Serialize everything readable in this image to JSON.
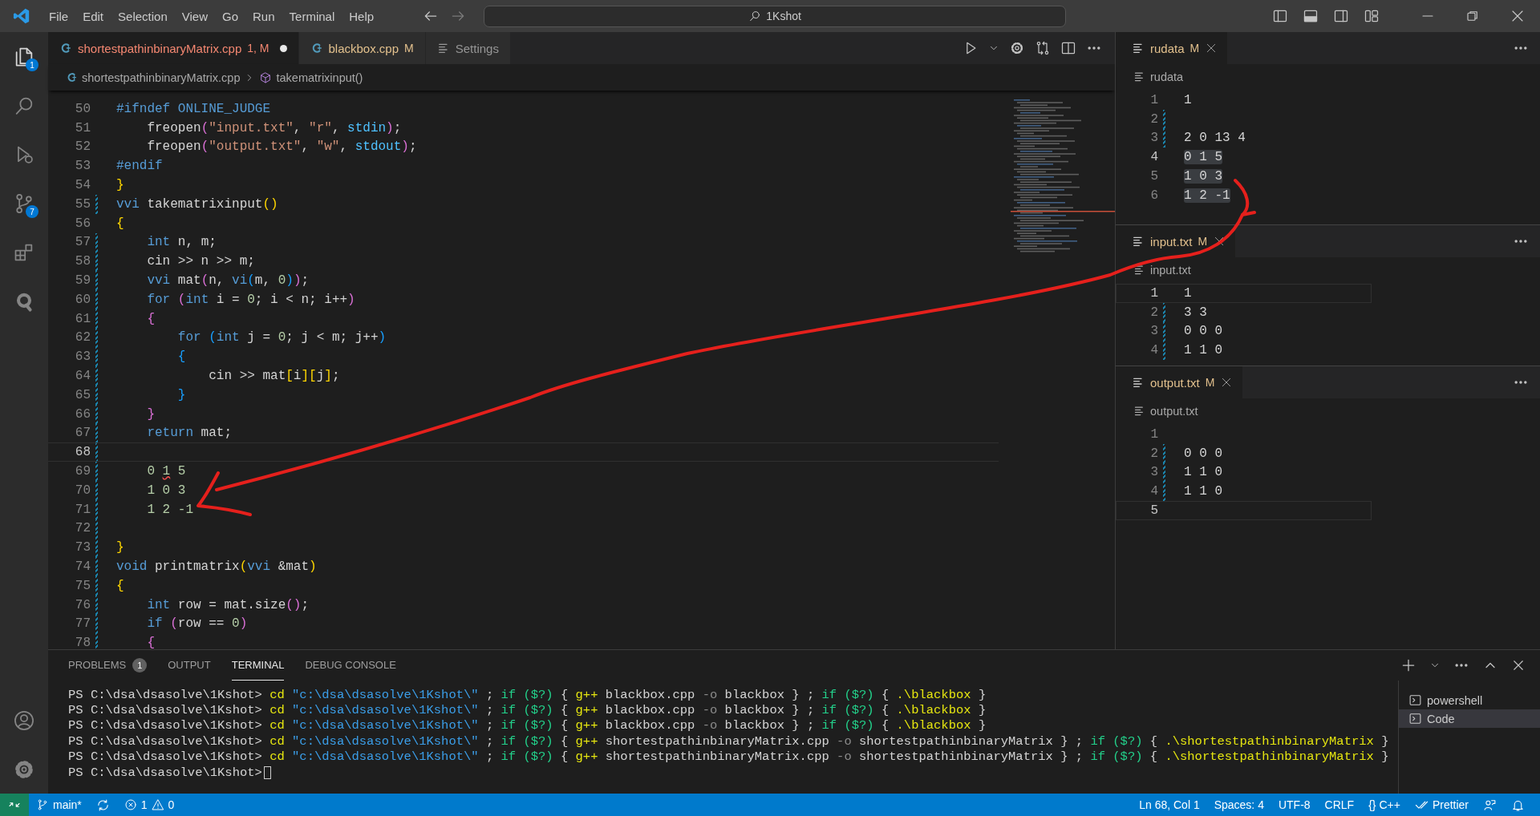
{
  "title_bar": {
    "menus": [
      "File",
      "Edit",
      "Selection",
      "View",
      "Go",
      "Run",
      "Terminal",
      "Help"
    ],
    "command_center": "1Kshot"
  },
  "activity_bar": {
    "items": [
      {
        "kind": "explorer",
        "badge": "1"
      },
      {
        "kind": "search"
      },
      {
        "kind": "debug"
      },
      {
        "kind": "scm",
        "badge": "7"
      },
      {
        "kind": "extensions"
      },
      {
        "kind": "qlogo"
      }
    ],
    "bottom": [
      {
        "kind": "account"
      },
      {
        "kind": "settings"
      }
    ]
  },
  "editor": {
    "tabs": [
      {
        "kind": "cpp",
        "label": "shortestpathinbinaryMatrix.cpp",
        "status": "1, M",
        "color": "#f48771",
        "selected": true,
        "dirty": true
      },
      {
        "kind": "cpp",
        "label": "blackbox.cpp",
        "status": "M",
        "color": "#e2c08d",
        "selected": false,
        "dirty": false
      },
      {
        "kind": "settings",
        "label": "Settings",
        "selected": false,
        "dirty": false
      }
    ],
    "breadcrumb": [
      "shortestpathinbinaryMatrix.cpp",
      "takematrixinput()"
    ],
    "lines": [
      {
        "n": "50",
        "modified": false,
        "current": false,
        "tokens": [
          {
            "text": "#ifndef ONLINE_JUDGE",
            "kind": "keyword"
          }
        ]
      },
      {
        "n": "51",
        "modified": false,
        "current": false,
        "tokens": [
          {
            "text": "    freopen",
            "kind": "plain"
          },
          {
            "text": "(",
            "kind": "bracket2"
          },
          {
            "text": "\"input.txt\"",
            "kind": "string"
          },
          {
            "text": ", ",
            "kind": "plain"
          },
          {
            "text": "\"r\"",
            "kind": "string"
          },
          {
            "text": ", ",
            "kind": "plain"
          },
          {
            "text": "stdin",
            "kind": "constant"
          },
          {
            "text": ")",
            "kind": "bracket2"
          },
          {
            "text": ";",
            "kind": "plain"
          }
        ]
      },
      {
        "n": "52",
        "modified": false,
        "current": false,
        "tokens": [
          {
            "text": "    freopen",
            "kind": "plain"
          },
          {
            "text": "(",
            "kind": "bracket2"
          },
          {
            "text": "\"output.txt\"",
            "kind": "string"
          },
          {
            "text": ", ",
            "kind": "plain"
          },
          {
            "text": "\"w\"",
            "kind": "string"
          },
          {
            "text": ", ",
            "kind": "plain"
          },
          {
            "text": "stdout",
            "kind": "constant"
          },
          {
            "text": ")",
            "kind": "bracket2"
          },
          {
            "text": ";",
            "kind": "plain"
          }
        ]
      },
      {
        "n": "53",
        "modified": false,
        "current": false,
        "tokens": [
          {
            "text": "#endif",
            "kind": "keyword"
          }
        ]
      },
      {
        "n": "54",
        "modified": false,
        "current": false,
        "tokens": [
          {
            "text": "}",
            "kind": "bracket1"
          }
        ]
      },
      {
        "n": "55",
        "modified": true,
        "current": false,
        "tokens": [
          {
            "text": "vvi",
            "kind": "keyword"
          },
          {
            "text": " takematrixinput",
            "kind": "plain"
          },
          {
            "text": "()",
            "kind": "bracket1"
          }
        ]
      },
      {
        "n": "56",
        "modified": false,
        "current": false,
        "tokens": [
          {
            "text": "{",
            "kind": "bracket1"
          }
        ]
      },
      {
        "n": "57",
        "modified": true,
        "current": false,
        "tokens": [
          {
            "text": "    int",
            "kind": "keyword"
          },
          {
            "text": " n, m;",
            "kind": "plain"
          }
        ]
      },
      {
        "n": "58",
        "modified": true,
        "current": false,
        "tokens": [
          {
            "text": "    cin >> n >> m;",
            "kind": "plain"
          }
        ]
      },
      {
        "n": "59",
        "modified": true,
        "current": false,
        "tokens": [
          {
            "text": "    vvi",
            "kind": "keyword"
          },
          {
            "text": " mat",
            "kind": "plain"
          },
          {
            "text": "(",
            "kind": "bracket2"
          },
          {
            "text": "n, ",
            "kind": "plain"
          },
          {
            "text": "vi",
            "kind": "keyword"
          },
          {
            "text": "(",
            "kind": "bracket3"
          },
          {
            "text": "m, ",
            "kind": "plain"
          },
          {
            "text": "0",
            "kind": "number"
          },
          {
            "text": ")",
            "kind": "bracket3"
          },
          {
            "text": ")",
            "kind": "bracket2"
          },
          {
            "text": ";",
            "kind": "plain"
          }
        ]
      },
      {
        "n": "60",
        "modified": true,
        "current": false,
        "tokens": [
          {
            "text": "    for",
            "kind": "keyword"
          },
          {
            "text": " (",
            "kind": "bracket2"
          },
          {
            "text": "int",
            "kind": "keyword"
          },
          {
            "text": " i = ",
            "kind": "plain"
          },
          {
            "text": "0",
            "kind": "number"
          },
          {
            "text": "; i < n; i++",
            "kind": "plain"
          },
          {
            "text": ")",
            "kind": "bracket2"
          }
        ]
      },
      {
        "n": "61",
        "modified": true,
        "current": false,
        "tokens": [
          {
            "text": "    {",
            "kind": "bracket2"
          }
        ]
      },
      {
        "n": "62",
        "modified": true,
        "current": false,
        "tokens": [
          {
            "text": "        for",
            "kind": "keyword"
          },
          {
            "text": " (",
            "kind": "bracket3"
          },
          {
            "text": "int",
            "kind": "keyword"
          },
          {
            "text": " j = ",
            "kind": "plain"
          },
          {
            "text": "0",
            "kind": "number"
          },
          {
            "text": "; j < m; j++",
            "kind": "plain"
          },
          {
            "text": ")",
            "kind": "bracket3"
          }
        ]
      },
      {
        "n": "63",
        "modified": true,
        "current": false,
        "tokens": [
          {
            "text": "        {",
            "kind": "bracket3"
          }
        ]
      },
      {
        "n": "64",
        "modified": true,
        "current": false,
        "tokens": [
          {
            "text": "            cin >> mat",
            "kind": "plain"
          },
          {
            "text": "[",
            "kind": "bracket1"
          },
          {
            "text": "i",
            "kind": "plain"
          },
          {
            "text": "][",
            "kind": "bracket1"
          },
          {
            "text": "j",
            "kind": "plain"
          },
          {
            "text": "]",
            "kind": "bracket1"
          },
          {
            "text": ";",
            "kind": "plain"
          }
        ]
      },
      {
        "n": "65",
        "modified": true,
        "current": false,
        "tokens": [
          {
            "text": "        }",
            "kind": "bracket3"
          }
        ]
      },
      {
        "n": "66",
        "modified": true,
        "current": false,
        "tokens": [
          {
            "text": "    }",
            "kind": "bracket2"
          }
        ]
      },
      {
        "n": "67",
        "modified": true,
        "current": false,
        "tokens": [
          {
            "text": "    return",
            "kind": "keyword"
          },
          {
            "text": " mat;",
            "kind": "plain"
          }
        ]
      },
      {
        "n": "68",
        "modified": true,
        "current": true
      },
      {
        "n": "69",
        "modified": true,
        "current": false,
        "tokens": [
          {
            "text": "    0 ",
            "kind": "number"
          },
          {
            "text": "1",
            "kind": "number_error"
          },
          {
            "text": " 5",
            "kind": "number"
          }
        ]
      },
      {
        "n": "70",
        "modified": true,
        "current": false,
        "tokens": [
          {
            "text": "    1 0 3",
            "kind": "number"
          }
        ]
      },
      {
        "n": "71",
        "modified": true,
        "current": false,
        "tokens": [
          {
            "text": "    1 2 -1",
            "kind": "number"
          }
        ]
      },
      {
        "n": "72",
        "modified": true,
        "current": false
      },
      {
        "n": "73",
        "modified": true,
        "current": false,
        "tokens": [
          {
            "text": "}",
            "kind": "bracket1"
          }
        ]
      },
      {
        "n": "74",
        "modified": true,
        "current": false,
        "tokens": [
          {
            "text": "void",
            "kind": "keyword"
          },
          {
            "text": " printmatrix",
            "kind": "plain"
          },
          {
            "text": "(",
            "kind": "bracket1"
          },
          {
            "text": "vvi",
            "kind": "keyword"
          },
          {
            "text": " &mat",
            "kind": "plain"
          },
          {
            "text": ")",
            "kind": "bracket1"
          }
        ]
      },
      {
        "n": "75",
        "modified": true,
        "current": false,
        "tokens": [
          {
            "text": "{",
            "kind": "bracket1"
          }
        ]
      },
      {
        "n": "76",
        "modified": true,
        "current": false,
        "tokens": [
          {
            "text": "    int",
            "kind": "keyword"
          },
          {
            "text": " row = mat.size",
            "kind": "plain"
          },
          {
            "text": "()",
            "kind": "bracket2"
          },
          {
            "text": ";",
            "kind": "plain"
          }
        ]
      },
      {
        "n": "77",
        "modified": true,
        "current": false,
        "tokens": [
          {
            "text": "    if",
            "kind": "keyword"
          },
          {
            "text": " (",
            "kind": "bracket2"
          },
          {
            "text": "row == ",
            "kind": "plain"
          },
          {
            "text": "0",
            "kind": "number"
          },
          {
            "text": ")",
            "kind": "bracket2"
          }
        ]
      },
      {
        "n": "78",
        "modified": true,
        "current": false,
        "tokens": [
          {
            "text": "    {",
            "kind": "bracket2"
          }
        ]
      }
    ]
  },
  "side_editors": [
    {
      "tab": "rudata",
      "status": "M",
      "color": "#e2c08d",
      "selected": true,
      "breadcrumb": "rudata",
      "lines": [
        {
          "n": "1",
          "text": "1",
          "modified": false,
          "current": false,
          "selected": false
        },
        {
          "n": "2",
          "modified": true,
          "current": false
        },
        {
          "n": "3",
          "text": "2 0 13 4",
          "modified": true,
          "current": false,
          "selected": false
        },
        {
          "n": "4",
          "text": "0 1 5",
          "modified": false,
          "current": true,
          "selected": true
        },
        {
          "n": "5",
          "text": "1 0 3",
          "modified": false,
          "current": false,
          "selected": true
        },
        {
          "n": "6",
          "text": "1 2 -1",
          "modified": false,
          "current": false,
          "selected": true
        }
      ]
    },
    {
      "tab": "input.txt",
      "status": "M",
      "color": "#e2c08d",
      "selected": true,
      "breadcrumb": "input.txt",
      "lines": [
        {
          "n": "1",
          "text": "1",
          "modified": false,
          "current": true,
          "selected": false
        },
        {
          "n": "2",
          "text": "3 3",
          "modified": true,
          "current": false,
          "selected": false
        },
        {
          "n": "3",
          "text": "0 0 0",
          "modified": true,
          "current": false,
          "selected": false
        },
        {
          "n": "4",
          "text": "1 1 0",
          "modified": true,
          "current": false,
          "selected": false
        }
      ]
    },
    {
      "tab": "output.txt",
      "status": "M",
      "color": "#e2c08d",
      "selected": true,
      "breadcrumb": "output.txt",
      "lines": [
        {
          "n": "1",
          "modified": false,
          "current": false
        },
        {
          "n": "2",
          "text": "0 0 0",
          "modified": true,
          "current": false,
          "selected": false
        },
        {
          "n": "3",
          "text": "1 1 0",
          "modified": true,
          "current": false,
          "selected": false
        },
        {
          "n": "4",
          "text": "1 1 0",
          "modified": true,
          "current": false,
          "selected": false
        },
        {
          "n": "5",
          "modified": false,
          "current": true
        }
      ]
    }
  ],
  "panel": {
    "tabs": [
      {
        "label": "PROBLEMS",
        "badge": "1",
        "selected": false
      },
      {
        "label": "OUTPUT",
        "selected": false
      },
      {
        "label": "TERMINAL",
        "selected": true
      },
      {
        "label": "DEBUG CONSOLE",
        "selected": false
      }
    ],
    "terminal": [
      {
        "cursor": false,
        "tokens": [
          {
            "text": "PS C:\\dsa\\dsasolve\\1Kshot> ",
            "kind": "plain"
          },
          {
            "text": "cd",
            "kind": "command"
          },
          {
            "text": " \"c:\\dsa\\dsasolve\\1Kshot\\\"",
            "kind": "path"
          },
          {
            "text": " ; ",
            "kind": "plain"
          },
          {
            "text": "if ($?)",
            "kind": "condition"
          },
          {
            "text": " { ",
            "kind": "plain"
          },
          {
            "text": "g++",
            "kind": "command"
          },
          {
            "text": " blackbox.cpp ",
            "kind": "plain"
          },
          {
            "text": "-o",
            "kind": "flag"
          },
          {
            "text": " blackbox } ; ",
            "kind": "plain"
          },
          {
            "text": "if ($?)",
            "kind": "condition"
          },
          {
            "text": " { ",
            "kind": "plain"
          },
          {
            "text": ".\\blackbox",
            "kind": "command"
          },
          {
            "text": " }",
            "kind": "plain"
          }
        ]
      },
      {
        "cursor": false,
        "tokens": [
          {
            "text": "PS C:\\dsa\\dsasolve\\1Kshot> ",
            "kind": "plain"
          },
          {
            "text": "cd",
            "kind": "command"
          },
          {
            "text": " \"c:\\dsa\\dsasolve\\1Kshot\\\"",
            "kind": "path"
          },
          {
            "text": " ; ",
            "kind": "plain"
          },
          {
            "text": "if ($?)",
            "kind": "condition"
          },
          {
            "text": " { ",
            "kind": "plain"
          },
          {
            "text": "g++",
            "kind": "command"
          },
          {
            "text": " blackbox.cpp ",
            "kind": "plain"
          },
          {
            "text": "-o",
            "kind": "flag"
          },
          {
            "text": " blackbox } ; ",
            "kind": "plain"
          },
          {
            "text": "if ($?)",
            "kind": "condition"
          },
          {
            "text": " { ",
            "kind": "plain"
          },
          {
            "text": ".\\blackbox",
            "kind": "command"
          },
          {
            "text": " }",
            "kind": "plain"
          }
        ]
      },
      {
        "cursor": false,
        "tokens": [
          {
            "text": "PS C:\\dsa\\dsasolve\\1Kshot> ",
            "kind": "plain"
          },
          {
            "text": "cd",
            "kind": "command"
          },
          {
            "text": " \"c:\\dsa\\dsasolve\\1Kshot\\\"",
            "kind": "path"
          },
          {
            "text": " ; ",
            "kind": "plain"
          },
          {
            "text": "if ($?)",
            "kind": "condition"
          },
          {
            "text": " { ",
            "kind": "plain"
          },
          {
            "text": "g++",
            "kind": "command"
          },
          {
            "text": " blackbox.cpp ",
            "kind": "plain"
          },
          {
            "text": "-o",
            "kind": "flag"
          },
          {
            "text": " blackbox } ; ",
            "kind": "plain"
          },
          {
            "text": "if ($?)",
            "kind": "condition"
          },
          {
            "text": " { ",
            "kind": "plain"
          },
          {
            "text": ".\\blackbox",
            "kind": "command"
          },
          {
            "text": " }",
            "kind": "plain"
          }
        ]
      },
      {
        "cursor": false,
        "tokens": [
          {
            "text": "PS C:\\dsa\\dsasolve\\1Kshot> ",
            "kind": "plain"
          },
          {
            "text": "cd",
            "kind": "command"
          },
          {
            "text": " \"c:\\dsa\\dsasolve\\1Kshot\\\"",
            "kind": "path"
          },
          {
            "text": " ; ",
            "kind": "plain"
          },
          {
            "text": "if ($?)",
            "kind": "condition"
          },
          {
            "text": " { ",
            "kind": "plain"
          },
          {
            "text": "g++",
            "kind": "command"
          },
          {
            "text": " shortestpathinbinaryMatrix.cpp ",
            "kind": "plain"
          },
          {
            "text": "-o",
            "kind": "flag"
          },
          {
            "text": " shortestpathinbinaryMatrix } ; ",
            "kind": "plain"
          },
          {
            "text": "if ($?)",
            "kind": "condition"
          },
          {
            "text": " { ",
            "kind": "plain"
          },
          {
            "text": ".\\shortestpathinbinaryMatrix",
            "kind": "command"
          },
          {
            "text": " }",
            "kind": "plain"
          }
        ]
      },
      {
        "cursor": false,
        "tokens": [
          {
            "text": "PS C:\\dsa\\dsasolve\\1Kshot> ",
            "kind": "plain"
          },
          {
            "text": "cd",
            "kind": "command"
          },
          {
            "text": " \"c:\\dsa\\dsasolve\\1Kshot\\\"",
            "kind": "path"
          },
          {
            "text": " ; ",
            "kind": "plain"
          },
          {
            "text": "if ($?)",
            "kind": "condition"
          },
          {
            "text": " { ",
            "kind": "plain"
          },
          {
            "text": "g++",
            "kind": "command"
          },
          {
            "text": " shortestpathinbinaryMatrix.cpp ",
            "kind": "plain"
          },
          {
            "text": "-o",
            "kind": "flag"
          },
          {
            "text": " shortestpathinbinaryMatrix } ; ",
            "kind": "plain"
          },
          {
            "text": "if ($?)",
            "kind": "condition"
          },
          {
            "text": " { ",
            "kind": "plain"
          },
          {
            "text": ".\\shortestpathinbinaryMatrix",
            "kind": "command"
          },
          {
            "text": " }",
            "kind": "plain"
          }
        ]
      },
      {
        "cursor": true,
        "tokens": [
          {
            "text": "PS C:\\dsa\\dsasolve\\1Kshot>",
            "kind": "plain"
          }
        ]
      }
    ],
    "terminals": [
      {
        "label": "powershell",
        "selected": false
      },
      {
        "label": "Code",
        "selected": true
      }
    ]
  },
  "status_bar": {
    "branch": "main*",
    "errors": "1",
    "warnings": "0",
    "items": [
      {
        "kind": "text",
        "text": "Ln 68, Col 1"
      },
      {
        "kind": "text",
        "text": "Spaces: 4"
      },
      {
        "kind": "text",
        "text": "UTF-8"
      },
      {
        "kind": "text",
        "text": "CRLF"
      },
      {
        "kind": "text",
        "text": "{} C++"
      },
      {
        "kind": "prettier",
        "text": "Prettier"
      }
    ]
  }
}
